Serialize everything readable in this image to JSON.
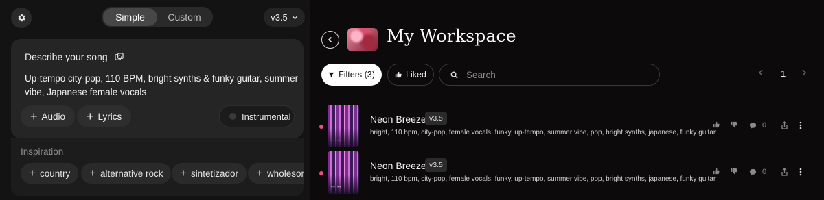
{
  "left": {
    "mode_tabs": [
      {
        "label": "Simple",
        "active": true
      },
      {
        "label": "Custom",
        "active": false
      }
    ],
    "version": "v3.5",
    "describe_title": "Describe your song",
    "prompt_text": "Up-tempo city-pop, 110 BPM, bright synths & funky guitar, summer vibe, Japanese female vocals",
    "buttons": {
      "audio": "Audio",
      "lyrics": "Lyrics",
      "instrumental": "Instrumental"
    },
    "inspiration_label": "Inspiration",
    "inspiration_tags": [
      "country",
      "alternative rock",
      "sintetizador",
      "wholesome"
    ]
  },
  "right": {
    "workspace_title": "My Workspace",
    "filters_label": "Filters (3)",
    "liked_label": "Liked",
    "search_placeholder": "Search",
    "page_number": "1",
    "songs": [
      {
        "title": "Neon Breeze",
        "version": "v3.5",
        "tags": "bright, 110 bpm, city-pop, female vocals, funky, up-tempo, summer vibe, pop, bright synths, japanese, funky guitar",
        "comments": "0",
        "time": "--:--"
      },
      {
        "title": "Neon Breeze",
        "version": "v3.5",
        "tags": "bright, 110 bpm, city-pop, female vocals, funky, up-tempo, summer vibe, pop, bright synths, japanese, funky guitar",
        "comments": "0",
        "time": "--:--"
      }
    ]
  },
  "colors": {
    "accent_dot": "#e8527c",
    "filters_bg": "#ffffff"
  }
}
